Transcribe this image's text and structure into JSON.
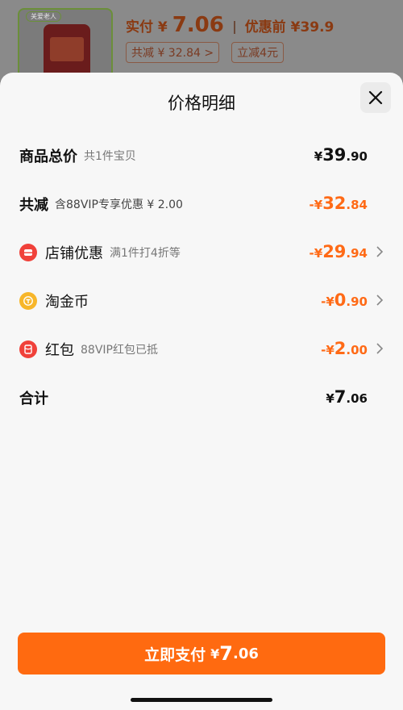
{
  "background": {
    "product_tag": "关爱老人",
    "paid_label": "实付",
    "paid_yen": "¥",
    "paid_amount": "7.06",
    "original_label": "优惠前",
    "original_amount": "¥39.9",
    "chip_reduction": "共减 ¥ 32.84 >",
    "chip_instant": "立减4元"
  },
  "sheet": {
    "title": "价格明细",
    "close_icon": "close-icon"
  },
  "rows": {
    "total": {
      "label": "商品总价",
      "sub": "共1件宝贝",
      "yen": "¥",
      "int": "39",
      "dec": ".90"
    },
    "reduce": {
      "label": "共减",
      "sub": "含88VIP专享优惠 ¥ 2.00",
      "yen": "-¥",
      "int": "32",
      "dec": ".84"
    },
    "store": {
      "label": "店铺优惠",
      "sub": "满1件打4折等",
      "yen": "-¥",
      "int": "29",
      "dec": ".94",
      "icon": "store-coupon-icon"
    },
    "coin": {
      "label": "淘金币",
      "sub": "",
      "yen": "-¥",
      "int": "0",
      "dec": ".90",
      "icon": "gold-coin-icon"
    },
    "redpacket": {
      "label": "红包",
      "sub": "88VIP红包已抵",
      "yen": "-¥",
      "int": "2",
      "dec": ".00",
      "icon": "red-packet-icon"
    },
    "sum": {
      "label": "合计",
      "yen": "¥",
      "int": "7",
      "dec": ".06"
    }
  },
  "pay_button": {
    "label": "立即支付",
    "yen": "¥",
    "int": "7",
    "dec": ".06"
  },
  "colors": {
    "accent": "#ff6a10",
    "discount": "#ff6a16",
    "icon_red": "#f0413a",
    "icon_gold": "#f7b62a"
  }
}
